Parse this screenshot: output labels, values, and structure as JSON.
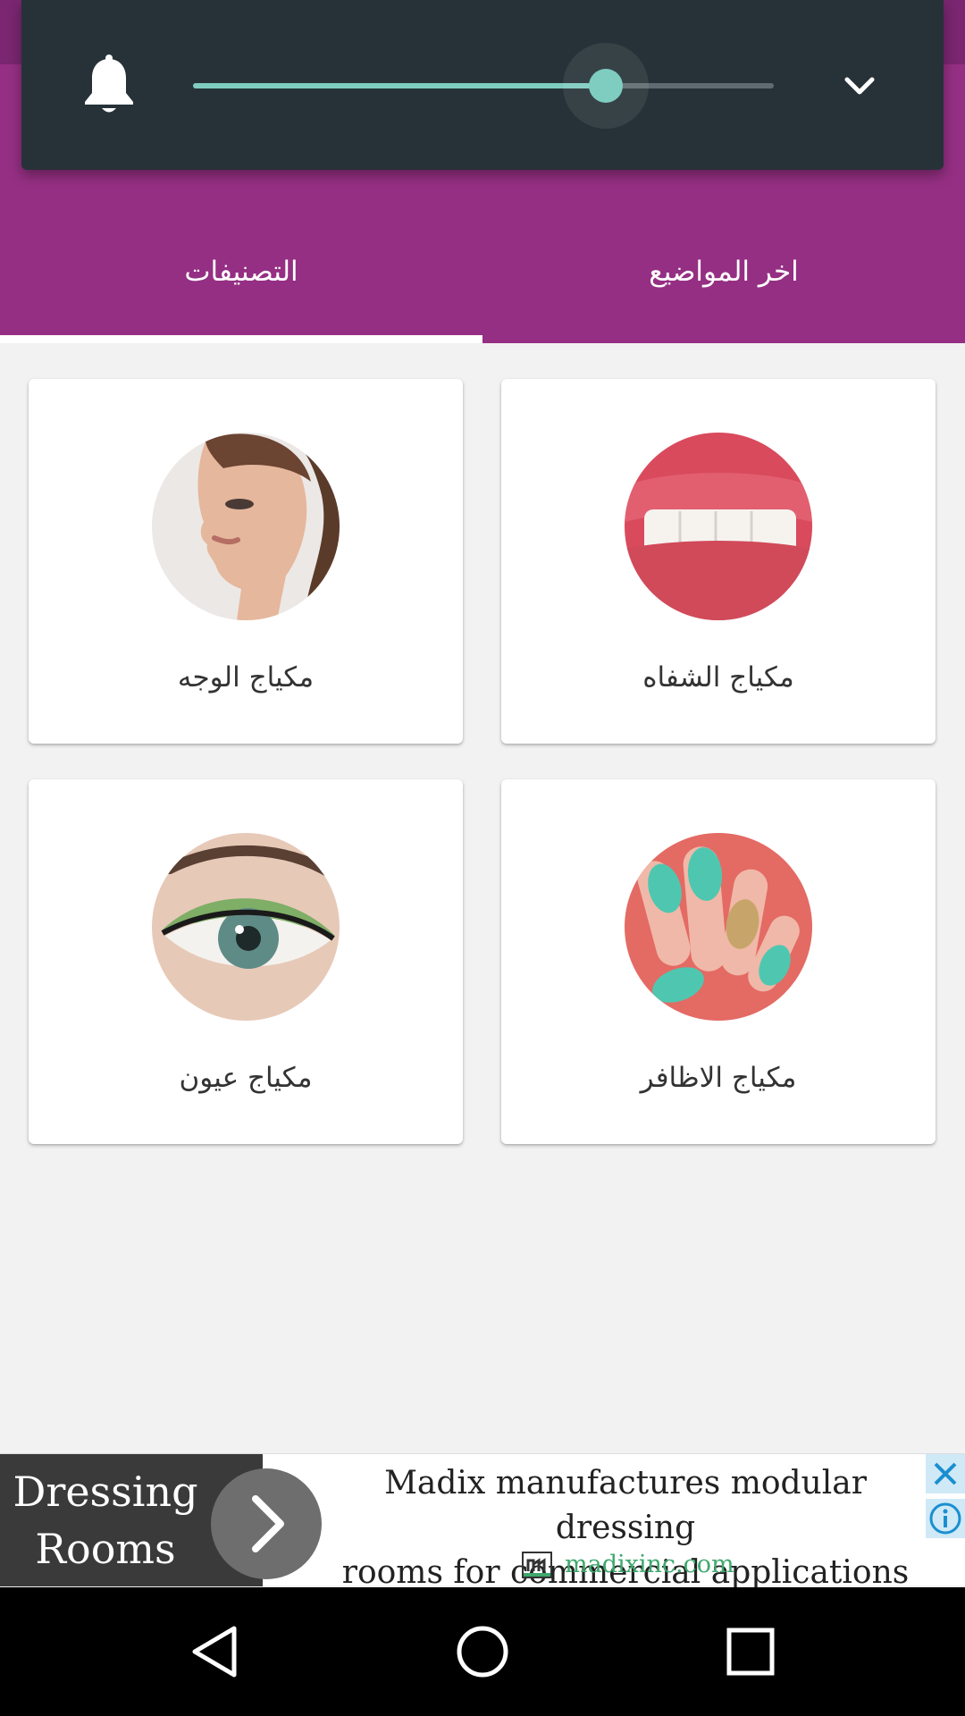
{
  "volume": {
    "level_fraction": 0.71,
    "accent": "#7ecdc0",
    "icons": [
      "bell-icon",
      "chevron-down-icon"
    ]
  },
  "tabs": [
    {
      "label": "التصنيفات",
      "selected": true
    },
    {
      "label": "اخر المواضيع",
      "selected": false
    }
  ],
  "categories": [
    {
      "label": "مكياج الوجه",
      "image": "face-photo"
    },
    {
      "label": "مكياج الشفاه",
      "image": "lips-photo"
    },
    {
      "label": "مكياج عيون",
      "image": "eye-photo"
    },
    {
      "label": "مكياج الاظافر",
      "image": "nails-photo"
    }
  ],
  "ad": {
    "title_line1": "Dressing",
    "title_line2": "Rooms",
    "text_line1": "Madix manufactures modular dressing",
    "text_line2": "rooms for commercial applications",
    "domain": "madixinc.com",
    "domain_color": "#3ea86d"
  },
  "nav": {
    "icons": [
      "back-icon",
      "home-icon",
      "recents-icon"
    ]
  },
  "colors": {
    "primary": "#952f83",
    "panel": "#263238"
  }
}
